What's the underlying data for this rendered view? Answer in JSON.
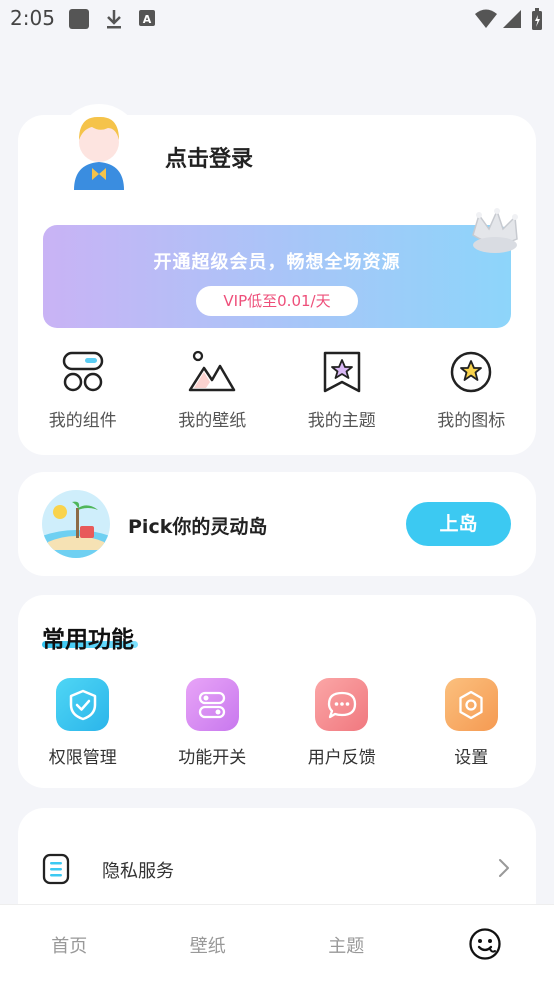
{
  "status_bar": {
    "time": "2:05",
    "left_icons": [
      "gallery-icon",
      "download-icon",
      "a-icon"
    ],
    "right_icons": [
      "wifi-icon",
      "signal-icon",
      "battery-icon"
    ]
  },
  "profile": {
    "login_text": "点击登录",
    "avatar_icon": "avatar-icon"
  },
  "vip": {
    "title": "开通超级会员，畅想全场资源",
    "button": "VIP低至0.01/天",
    "crown_icon": "crown-icon"
  },
  "my_items": [
    {
      "label": "我的组件",
      "icon": "widget-icon"
    },
    {
      "label": "我的壁纸",
      "icon": "wallpaper-icon"
    },
    {
      "label": "我的主题",
      "icon": "theme-icon"
    },
    {
      "label": "我的图标",
      "icon": "icon-pack-icon"
    }
  ],
  "island": {
    "text": "Pick你的灵动岛",
    "button": "上岛"
  },
  "common": {
    "title": "常用功能",
    "items": [
      {
        "label": "权限管理",
        "icon": "shield-check-icon",
        "color": "#35c6f0"
      },
      {
        "label": "功能开关",
        "icon": "toggle-icon",
        "color": "#d98cf2"
      },
      {
        "label": "用户反馈",
        "icon": "chat-bubble-icon",
        "color": "#f78f93"
      },
      {
        "label": "设置",
        "icon": "gear-icon",
        "color": "#f8a963"
      }
    ]
  },
  "list": [
    {
      "label": "隐私服务",
      "icon": "document-icon"
    }
  ],
  "nav": {
    "home": "首页",
    "wallpaper": "壁纸",
    "theme": "主题",
    "me_icon": "smiley-face-icon"
  }
}
